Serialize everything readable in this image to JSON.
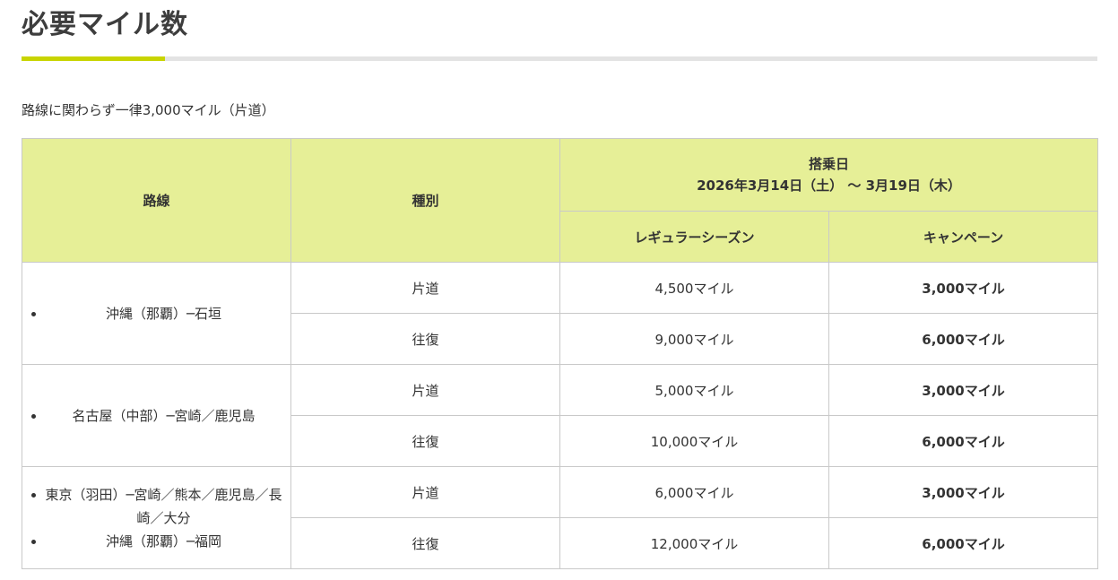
{
  "page": {
    "title": "必要マイル数",
    "lead": "路線に関わらず一律3,000マイル（片道）",
    "accent_color": "#c8d400",
    "header_bg_color": "#e6ef97"
  },
  "table": {
    "headers": {
      "route": "路線",
      "type": "種別",
      "boarding_date_label": "搭乗日",
      "boarding_date_range": "2026年3月14日（土） ～ 3月19日（木）",
      "regular": "レギュラーシーズン",
      "campaign": "キャンペーン"
    },
    "groups": [
      {
        "routes": [
          "沖縄（那覇）─石垣"
        ],
        "rows": [
          {
            "type": "片道",
            "regular": "4,500マイル",
            "campaign": "3,000マイル"
          },
          {
            "type": "往復",
            "regular": "9,000マイル",
            "campaign": "6,000マイル"
          }
        ]
      },
      {
        "routes": [
          "名古屋（中部）─宮崎／鹿児島"
        ],
        "rows": [
          {
            "type": "片道",
            "regular": "5,000マイル",
            "campaign": "3,000マイル"
          },
          {
            "type": "往復",
            "regular": "10,000マイル",
            "campaign": "6,000マイル"
          }
        ]
      },
      {
        "routes": [
          "東京（羽田）─宮崎／熊本／鹿児島／長崎／大分",
          "沖縄（那覇）─福岡"
        ],
        "rows": [
          {
            "type": "片道",
            "regular": "6,000マイル",
            "campaign": "3,000マイル"
          },
          {
            "type": "往復",
            "regular": "12,000マイル",
            "campaign": "6,000マイル"
          }
        ]
      }
    ]
  }
}
